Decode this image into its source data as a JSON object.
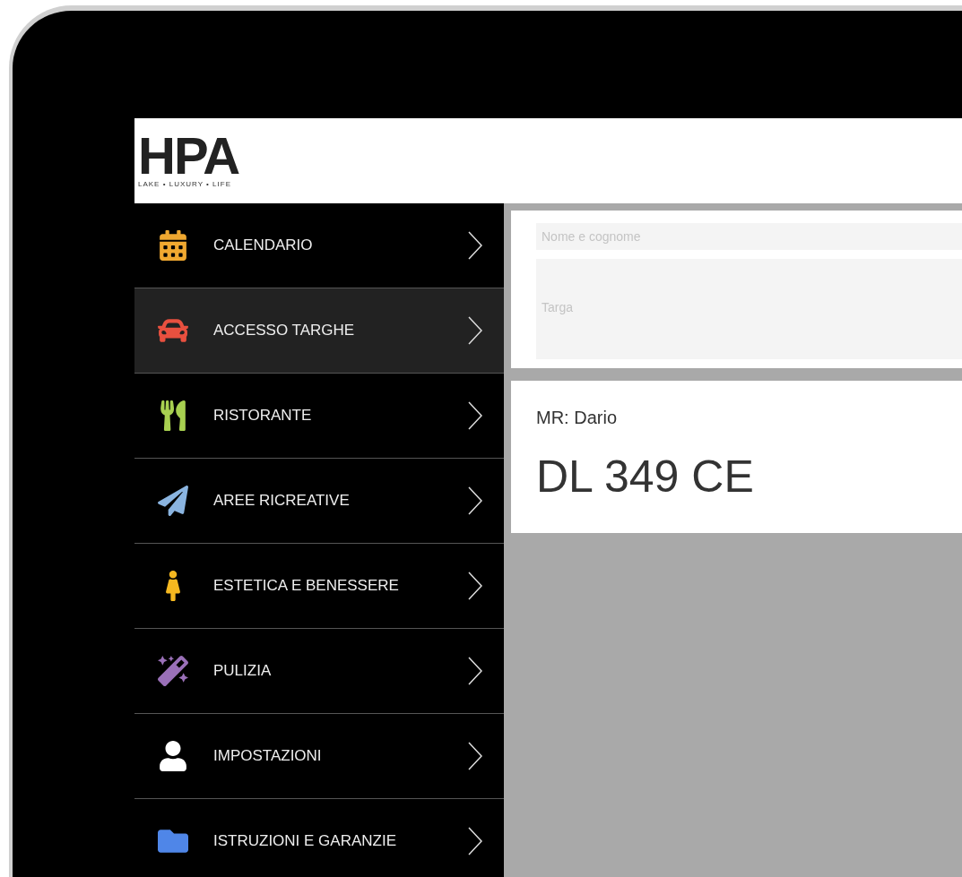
{
  "header": {
    "logo": "HPA",
    "tagline": "LAKE • LUXURY • LIFE"
  },
  "menu": [
    {
      "label": "CALENDARIO",
      "selected": false,
      "color": "#f0a830"
    },
    {
      "label": "ACCESSO TARGHE",
      "selected": true,
      "color": "#e8503f"
    },
    {
      "label": "RISTORANTE",
      "selected": false,
      "color": "#a8d050"
    },
    {
      "label": "AREE RICREATIVE",
      "selected": false,
      "color": "#8ab4e0"
    },
    {
      "label": "ESTETICA E BENESSERE",
      "selected": false,
      "color": "#f5b820"
    },
    {
      "label": "PULIZIA",
      "selected": false,
      "color": "#9a70b8"
    },
    {
      "label": "IMPOSTAZIONI",
      "selected": false,
      "color": "#ffffff"
    },
    {
      "label": "ISTRUZIONI E GARANZIE",
      "selected": false,
      "color": "#4f86e8"
    }
  ],
  "form": {
    "name_field": {
      "placeholder": "Nome e cognome"
    },
    "plate_field": {
      "placeholder": "Targa"
    }
  },
  "result": {
    "owner": "MR: Dario",
    "plate": "DL 349 CE"
  }
}
